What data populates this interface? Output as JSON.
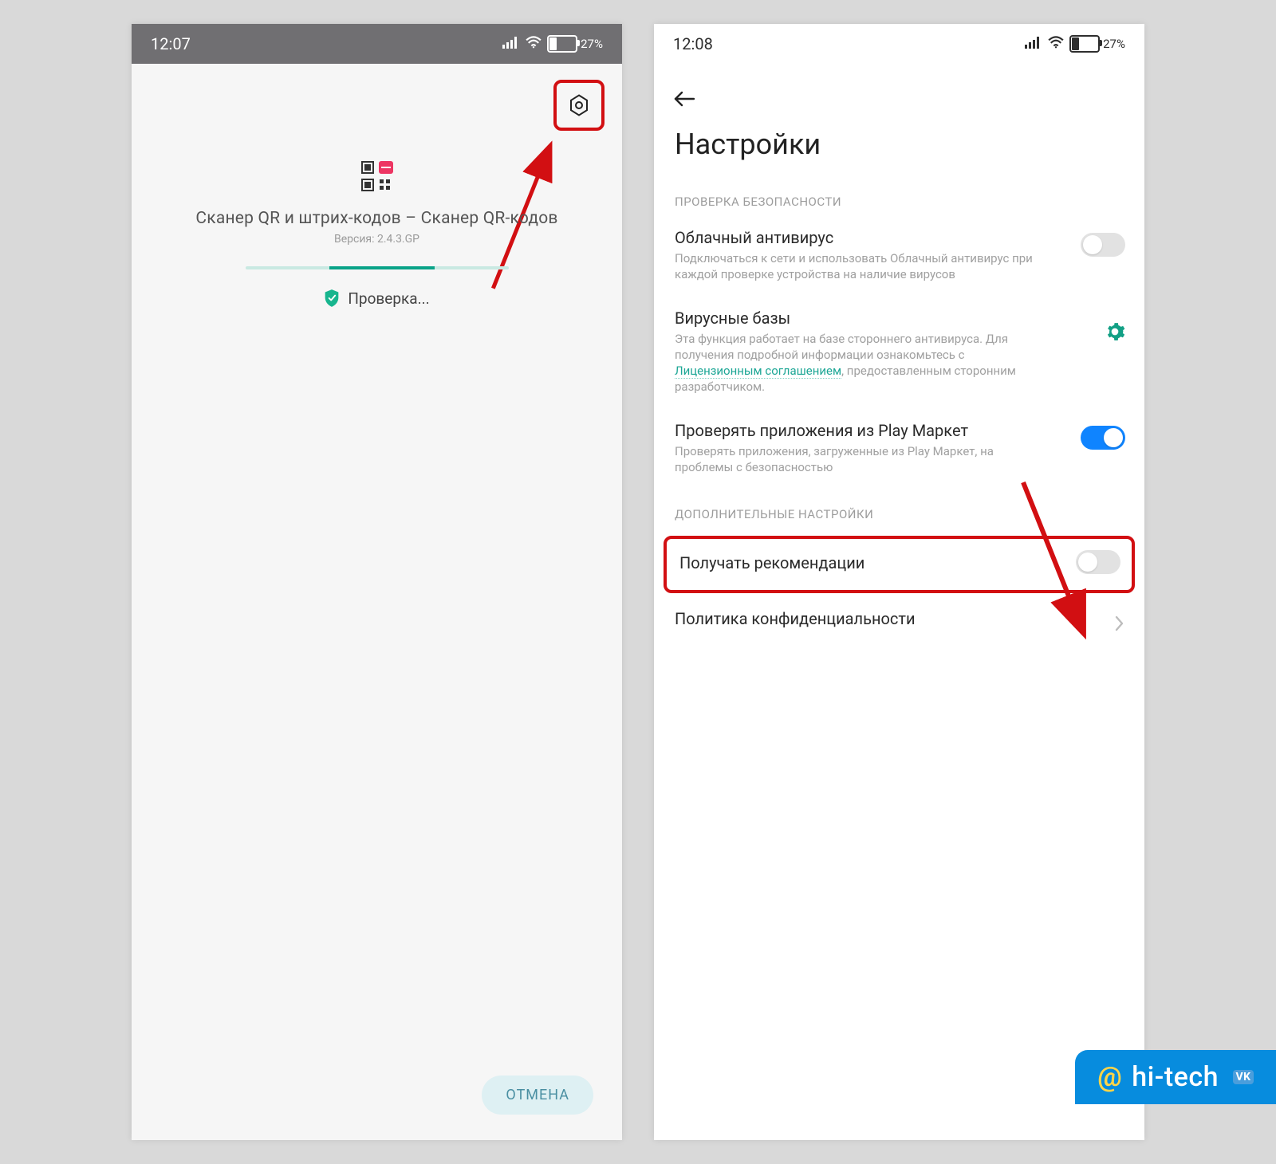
{
  "left": {
    "status_time": "12:07",
    "battery_pct": "27",
    "battery_unit": "%",
    "app_title": "Сканер QR и штрих-кодов – Сканер QR-кодов",
    "app_version": "Версия: 2.4.3.GP",
    "checking_label": "Проверка...",
    "cancel_label": "ОТМЕНА"
  },
  "right": {
    "status_time": "12:08",
    "battery_pct": "27",
    "battery_unit": "%",
    "page_title": "Настройки",
    "section1": "ПРОВЕРКА БЕЗОПАСНОСТИ",
    "row1": {
      "title": "Облачный антивирус",
      "desc": "Подключаться к сети и использовать Облачный антивирус при каждой проверке устройства на наличие вирусов"
    },
    "row2": {
      "title": "Вирусные базы",
      "desc_pre": "Эта функция работает на базе стороннего антивируса. Для получения подробной информации ознакомьтесь с ",
      "link": "Лицензионным соглашением",
      "desc_post": ", предоставленным сторонним разработчиком."
    },
    "row3": {
      "title": "Проверять приложения из Play Маркет",
      "desc": "Проверять приложения, загруженные из Play Маркет, на проблемы с безопасностью"
    },
    "section2": "ДОПОЛНИТЕЛЬНЫЕ НАСТРОЙКИ",
    "row4": {
      "title": "Получать рекомендации"
    },
    "row5": {
      "title": "Политика конфиденциальности"
    }
  },
  "watermark": {
    "at": "@",
    "text": "hi-tech",
    "vk": "VK"
  }
}
